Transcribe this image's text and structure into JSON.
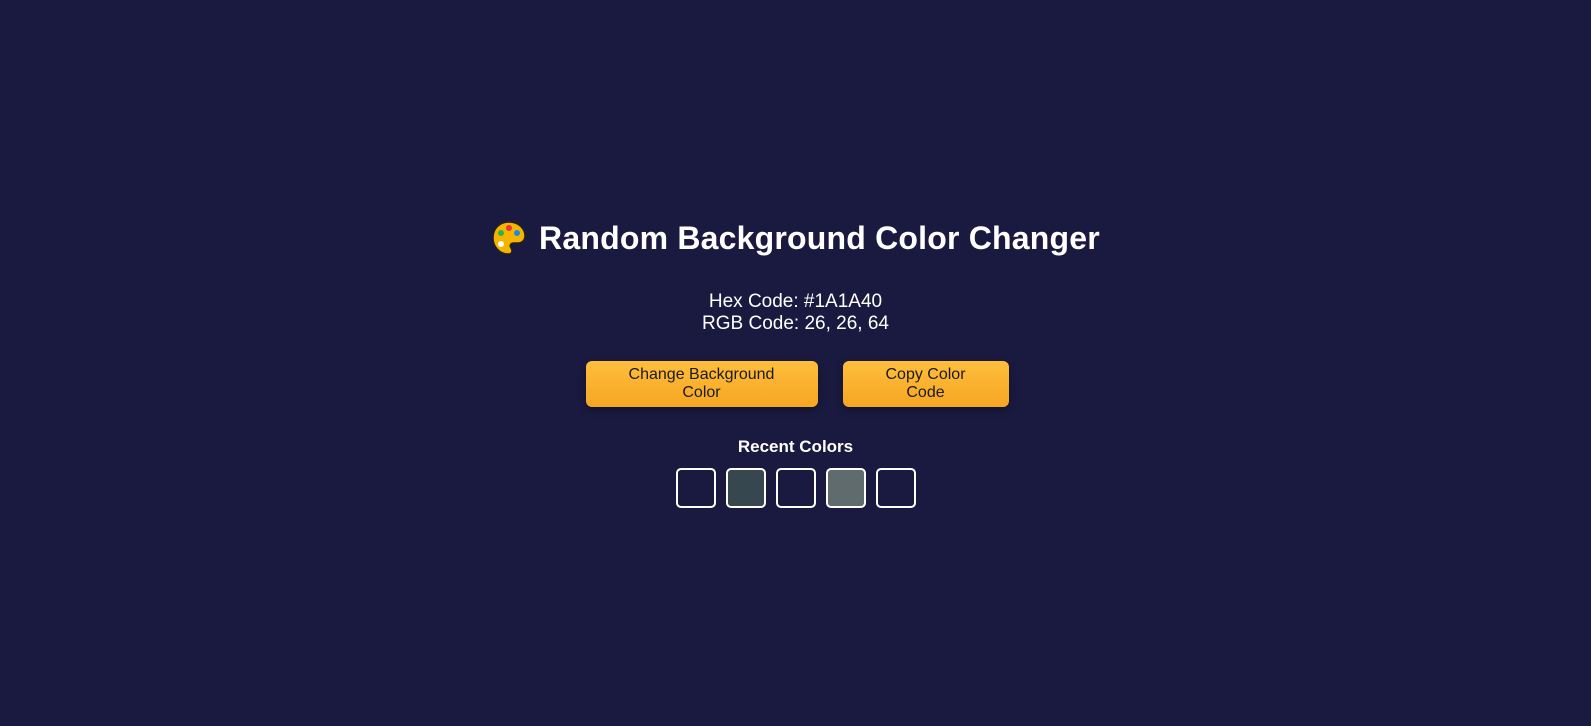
{
  "page": {
    "background": "#1A1A40",
    "title": "Random Background Color Changer",
    "icon": "palette-icon"
  },
  "codes": {
    "hex": "Hex Code: #1A1A40",
    "rgb": "RGB Code: 26, 26, 64"
  },
  "buttons": {
    "change_label": "Change Background Color",
    "copy_label": "Copy Color Code",
    "accent": "#F5A623"
  },
  "recent": {
    "title": "Recent Colors",
    "swatches": [
      "#1A1A40",
      "#37474F",
      "#1A1A40",
      "#5F6B6C",
      "#1A1A40"
    ]
  }
}
